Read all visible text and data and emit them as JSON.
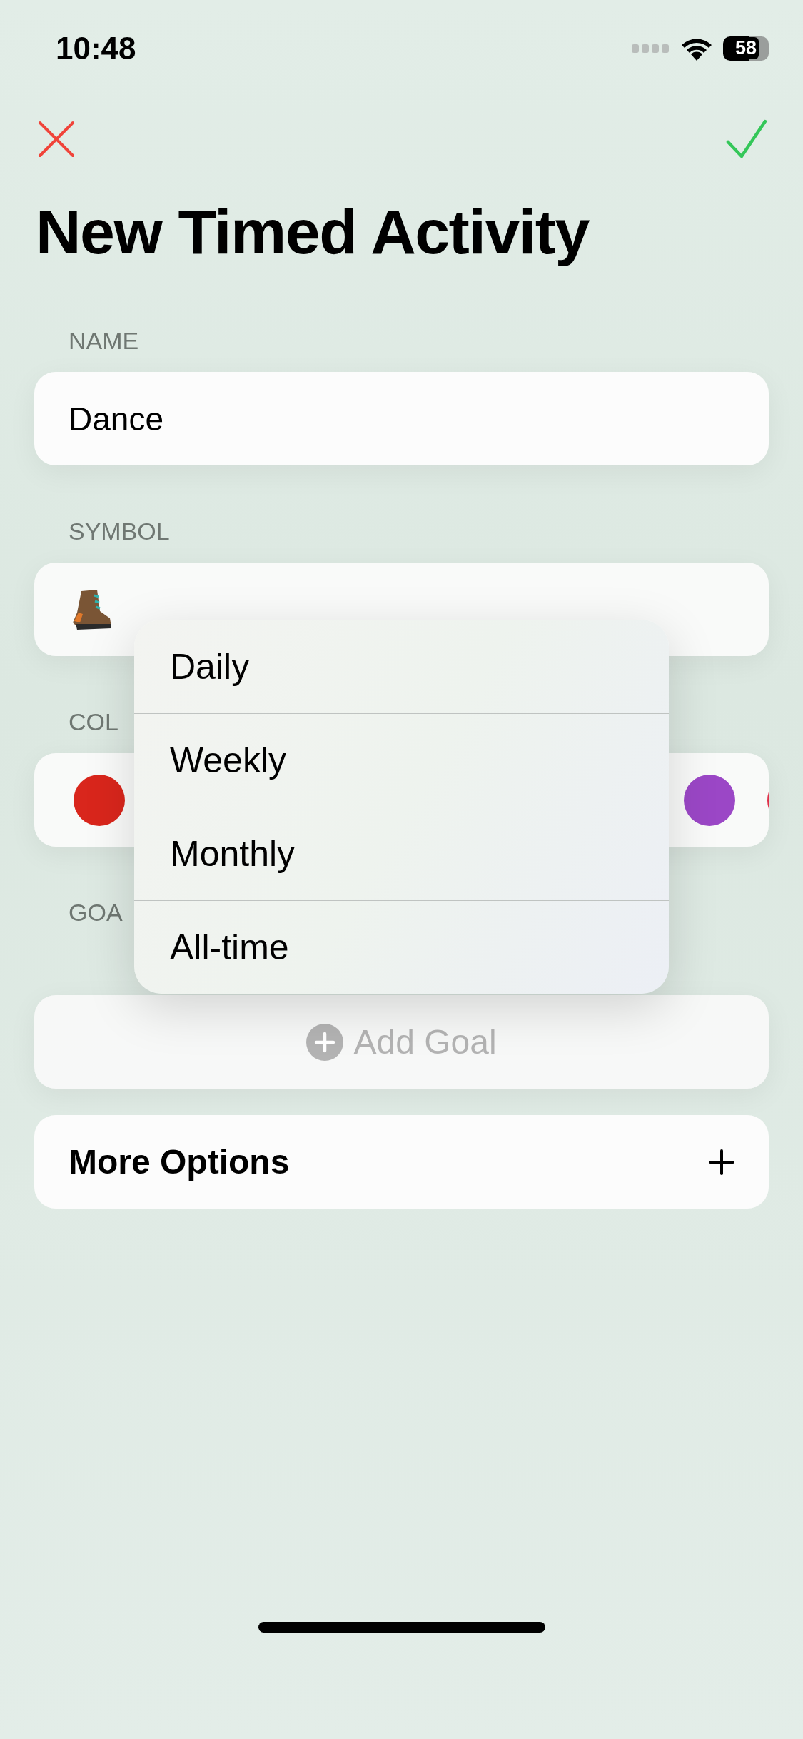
{
  "status_bar": {
    "time": "10:48",
    "battery": "58"
  },
  "title": "New Timed Activity",
  "name_section": {
    "label": "NAME",
    "value": "Dance"
  },
  "symbol_section": {
    "label": "SYMBOL"
  },
  "color_section": {
    "label": "COL",
    "colors": [
      {
        "color": "#d9261c"
      },
      {
        "color": "#9b47c6"
      },
      {
        "color": "#e0304a"
      }
    ]
  },
  "goal_section": {
    "label": "GOA",
    "button": "Add Goal"
  },
  "more_options": {
    "label": "More Options"
  },
  "menu": {
    "items": [
      {
        "label": "Daily"
      },
      {
        "label": "Weekly"
      },
      {
        "label": "Monthly"
      },
      {
        "label": "All-time"
      }
    ]
  }
}
